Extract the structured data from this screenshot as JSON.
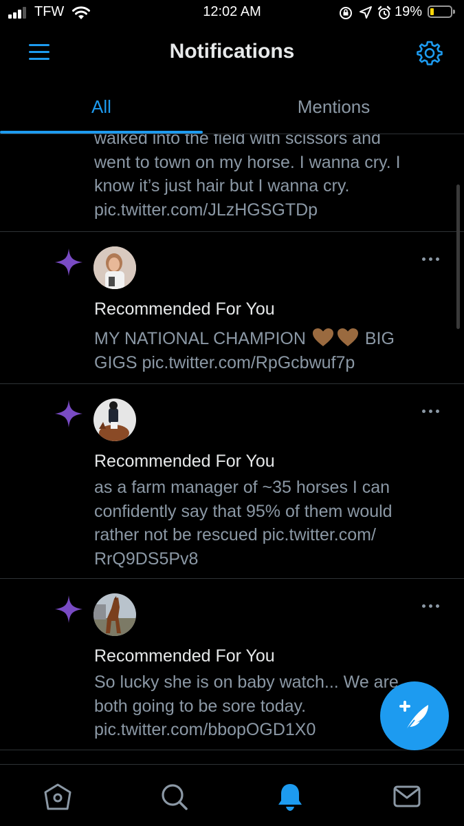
{
  "status_bar": {
    "carrier": "TFW",
    "time": "12:02 AM",
    "battery_percent": "19%",
    "battery_level": 0.19,
    "icons": [
      "signal-icon",
      "wifi-icon",
      "orientation-lock-icon",
      "location-icon",
      "alarm-icon",
      "battery-icon"
    ]
  },
  "header": {
    "title": "Notifications",
    "left_icon": "menu-icon",
    "right_icon": "gear-icon"
  },
  "tabs": [
    {
      "label": "All",
      "active": true
    },
    {
      "label": "Mentions",
      "active": false
    }
  ],
  "feed": {
    "partial_tweet": {
      "lines": [
        "walked into the field with scissors and",
        "went to town on my horse. I wanna cry. I",
        "know it’s just hair but I wanna cry.",
        "pic.twitter.com/JLzHGSGTDp"
      ]
    },
    "items": [
      {
        "label": "Recommended For You",
        "lines": [
          "MY NATIONAL CHAMPION",
          "BIG",
          "GIGS pic.twitter.com/RpGcbwuf7p"
        ],
        "emoji": "brown-heart-icon"
      },
      {
        "label": "Recommended For You",
        "lines": [
          "as a farm manager of ~35 horses I can",
          "confidently say that 95% of them would",
          "rather not be rescued pic.twitter.com/",
          "RrQ9DS5Pv8"
        ]
      },
      {
        "label": "Recommended For You",
        "lines": [
          "So lucky she is on baby watch... We are",
          "both going to be sore today.",
          "pic.twitter.com/bbopOGD1X0"
        ]
      }
    ]
  },
  "bottom_nav": [
    {
      "name": "home-icon",
      "active": false
    },
    {
      "name": "search-icon",
      "active": false
    },
    {
      "name": "notifications-bell-icon",
      "active": true
    },
    {
      "name": "messages-icon",
      "active": false
    }
  ],
  "colors": {
    "accent": "#1d9bf0",
    "sparkle": "#794bc4",
    "muted_text": "#8b98a5",
    "background": "#000000"
  }
}
